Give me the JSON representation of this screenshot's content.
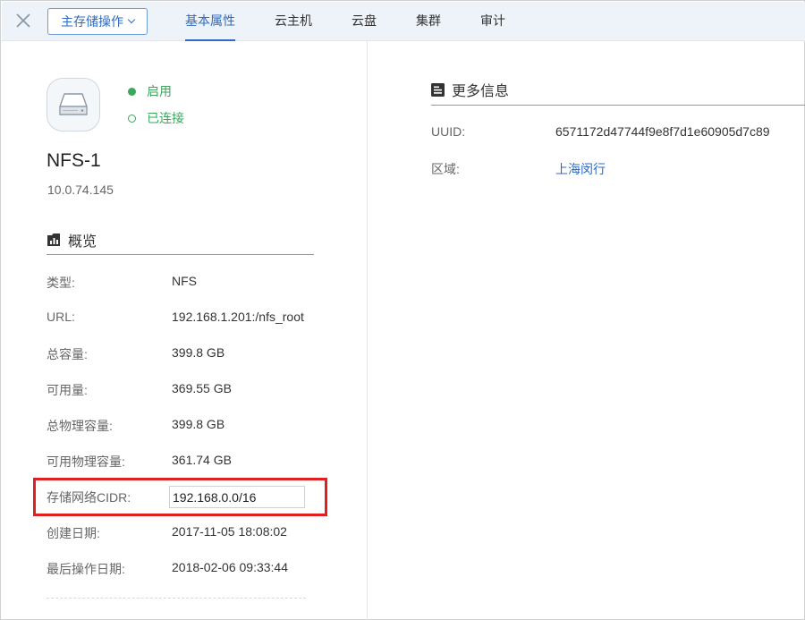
{
  "topbar": {
    "ops_label": "主存储操作",
    "tabs": [
      {
        "label": "基本属性",
        "active": true
      },
      {
        "label": "云主机"
      },
      {
        "label": "云盘"
      },
      {
        "label": "集群"
      },
      {
        "label": "审计"
      }
    ]
  },
  "resource": {
    "icon": "hard-disk-icon",
    "status": [
      {
        "label": "启用",
        "icon": "filled-dot-icon",
        "color": "#3aa75c"
      },
      {
        "label": "已连接",
        "icon": "ring-dot-icon",
        "color": "#3aa75c"
      }
    ],
    "name": "NFS-1",
    "ip": "10.0.74.145"
  },
  "overview": {
    "title": "概览",
    "rows": [
      {
        "key": "类型:",
        "value": "NFS"
      },
      {
        "key": "URL:",
        "value": "192.168.1.201:/nfs_root"
      },
      {
        "key": "总容量:",
        "value": "399.8 GB"
      },
      {
        "key": "可用量:",
        "value": "369.55 GB"
      },
      {
        "key": "总物理容量:",
        "value": "399.8 GB"
      },
      {
        "key": "可用物理容量:",
        "value": "361.74 GB"
      }
    ],
    "cidr": {
      "key": "存储网络CIDR:",
      "value": "192.168.0.0/16",
      "highlight_color": "#e02020"
    },
    "rows2": [
      {
        "key": "创建日期:",
        "value": "2017-11-05 18:08:02"
      },
      {
        "key": "最后操作日期:",
        "value": "2018-02-06 09:33:44"
      }
    ]
  },
  "more_info": {
    "title": "更多信息",
    "rows": [
      {
        "key": "UUID:",
        "value": "6571172d47744f9e8f7d1e60905d7c89"
      },
      {
        "key": "区域:",
        "value": "上海闵行",
        "link": true
      }
    ]
  },
  "colors": {
    "accent": "#2f6bc2",
    "status_green": "#3aa75c"
  }
}
